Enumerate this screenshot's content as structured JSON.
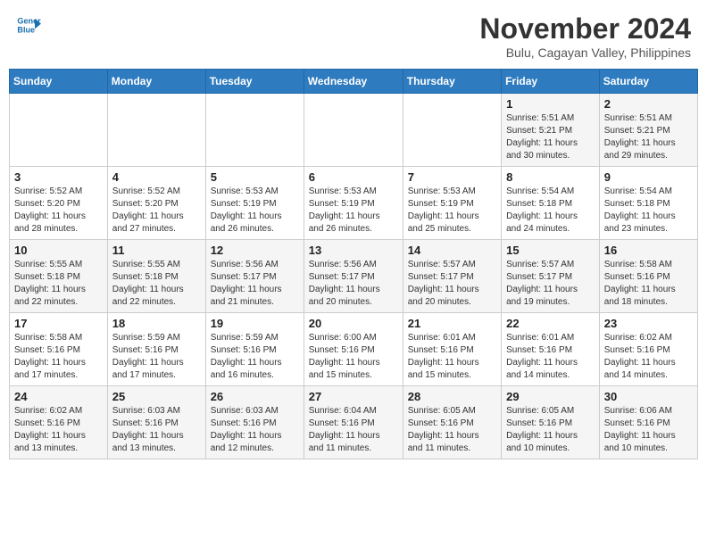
{
  "header": {
    "logo_line1": "General",
    "logo_line2": "Blue",
    "month": "November 2024",
    "location": "Bulu, Cagayan Valley, Philippines"
  },
  "weekdays": [
    "Sunday",
    "Monday",
    "Tuesday",
    "Wednesday",
    "Thursday",
    "Friday",
    "Saturday"
  ],
  "weeks": [
    [
      {
        "day": "",
        "info": ""
      },
      {
        "day": "",
        "info": ""
      },
      {
        "day": "",
        "info": ""
      },
      {
        "day": "",
        "info": ""
      },
      {
        "day": "",
        "info": ""
      },
      {
        "day": "1",
        "info": "Sunrise: 5:51 AM\nSunset: 5:21 PM\nDaylight: 11 hours\nand 30 minutes."
      },
      {
        "day": "2",
        "info": "Sunrise: 5:51 AM\nSunset: 5:21 PM\nDaylight: 11 hours\nand 29 minutes."
      }
    ],
    [
      {
        "day": "3",
        "info": "Sunrise: 5:52 AM\nSunset: 5:20 PM\nDaylight: 11 hours\nand 28 minutes."
      },
      {
        "day": "4",
        "info": "Sunrise: 5:52 AM\nSunset: 5:20 PM\nDaylight: 11 hours\nand 27 minutes."
      },
      {
        "day": "5",
        "info": "Sunrise: 5:53 AM\nSunset: 5:19 PM\nDaylight: 11 hours\nand 26 minutes."
      },
      {
        "day": "6",
        "info": "Sunrise: 5:53 AM\nSunset: 5:19 PM\nDaylight: 11 hours\nand 26 minutes."
      },
      {
        "day": "7",
        "info": "Sunrise: 5:53 AM\nSunset: 5:19 PM\nDaylight: 11 hours\nand 25 minutes."
      },
      {
        "day": "8",
        "info": "Sunrise: 5:54 AM\nSunset: 5:18 PM\nDaylight: 11 hours\nand 24 minutes."
      },
      {
        "day": "9",
        "info": "Sunrise: 5:54 AM\nSunset: 5:18 PM\nDaylight: 11 hours\nand 23 minutes."
      }
    ],
    [
      {
        "day": "10",
        "info": "Sunrise: 5:55 AM\nSunset: 5:18 PM\nDaylight: 11 hours\nand 22 minutes."
      },
      {
        "day": "11",
        "info": "Sunrise: 5:55 AM\nSunset: 5:18 PM\nDaylight: 11 hours\nand 22 minutes."
      },
      {
        "day": "12",
        "info": "Sunrise: 5:56 AM\nSunset: 5:17 PM\nDaylight: 11 hours\nand 21 minutes."
      },
      {
        "day": "13",
        "info": "Sunrise: 5:56 AM\nSunset: 5:17 PM\nDaylight: 11 hours\nand 20 minutes."
      },
      {
        "day": "14",
        "info": "Sunrise: 5:57 AM\nSunset: 5:17 PM\nDaylight: 11 hours\nand 20 minutes."
      },
      {
        "day": "15",
        "info": "Sunrise: 5:57 AM\nSunset: 5:17 PM\nDaylight: 11 hours\nand 19 minutes."
      },
      {
        "day": "16",
        "info": "Sunrise: 5:58 AM\nSunset: 5:16 PM\nDaylight: 11 hours\nand 18 minutes."
      }
    ],
    [
      {
        "day": "17",
        "info": "Sunrise: 5:58 AM\nSunset: 5:16 PM\nDaylight: 11 hours\nand 17 minutes."
      },
      {
        "day": "18",
        "info": "Sunrise: 5:59 AM\nSunset: 5:16 PM\nDaylight: 11 hours\nand 17 minutes."
      },
      {
        "day": "19",
        "info": "Sunrise: 5:59 AM\nSunset: 5:16 PM\nDaylight: 11 hours\nand 16 minutes."
      },
      {
        "day": "20",
        "info": "Sunrise: 6:00 AM\nSunset: 5:16 PM\nDaylight: 11 hours\nand 15 minutes."
      },
      {
        "day": "21",
        "info": "Sunrise: 6:01 AM\nSunset: 5:16 PM\nDaylight: 11 hours\nand 15 minutes."
      },
      {
        "day": "22",
        "info": "Sunrise: 6:01 AM\nSunset: 5:16 PM\nDaylight: 11 hours\nand 14 minutes."
      },
      {
        "day": "23",
        "info": "Sunrise: 6:02 AM\nSunset: 5:16 PM\nDaylight: 11 hours\nand 14 minutes."
      }
    ],
    [
      {
        "day": "24",
        "info": "Sunrise: 6:02 AM\nSunset: 5:16 PM\nDaylight: 11 hours\nand 13 minutes."
      },
      {
        "day": "25",
        "info": "Sunrise: 6:03 AM\nSunset: 5:16 PM\nDaylight: 11 hours\nand 13 minutes."
      },
      {
        "day": "26",
        "info": "Sunrise: 6:03 AM\nSunset: 5:16 PM\nDaylight: 11 hours\nand 12 minutes."
      },
      {
        "day": "27",
        "info": "Sunrise: 6:04 AM\nSunset: 5:16 PM\nDaylight: 11 hours\nand 11 minutes."
      },
      {
        "day": "28",
        "info": "Sunrise: 6:05 AM\nSunset: 5:16 PM\nDaylight: 11 hours\nand 11 minutes."
      },
      {
        "day": "29",
        "info": "Sunrise: 6:05 AM\nSunset: 5:16 PM\nDaylight: 11 hours\nand 10 minutes."
      },
      {
        "day": "30",
        "info": "Sunrise: 6:06 AM\nSunset: 5:16 PM\nDaylight: 11 hours\nand 10 minutes."
      }
    ]
  ]
}
